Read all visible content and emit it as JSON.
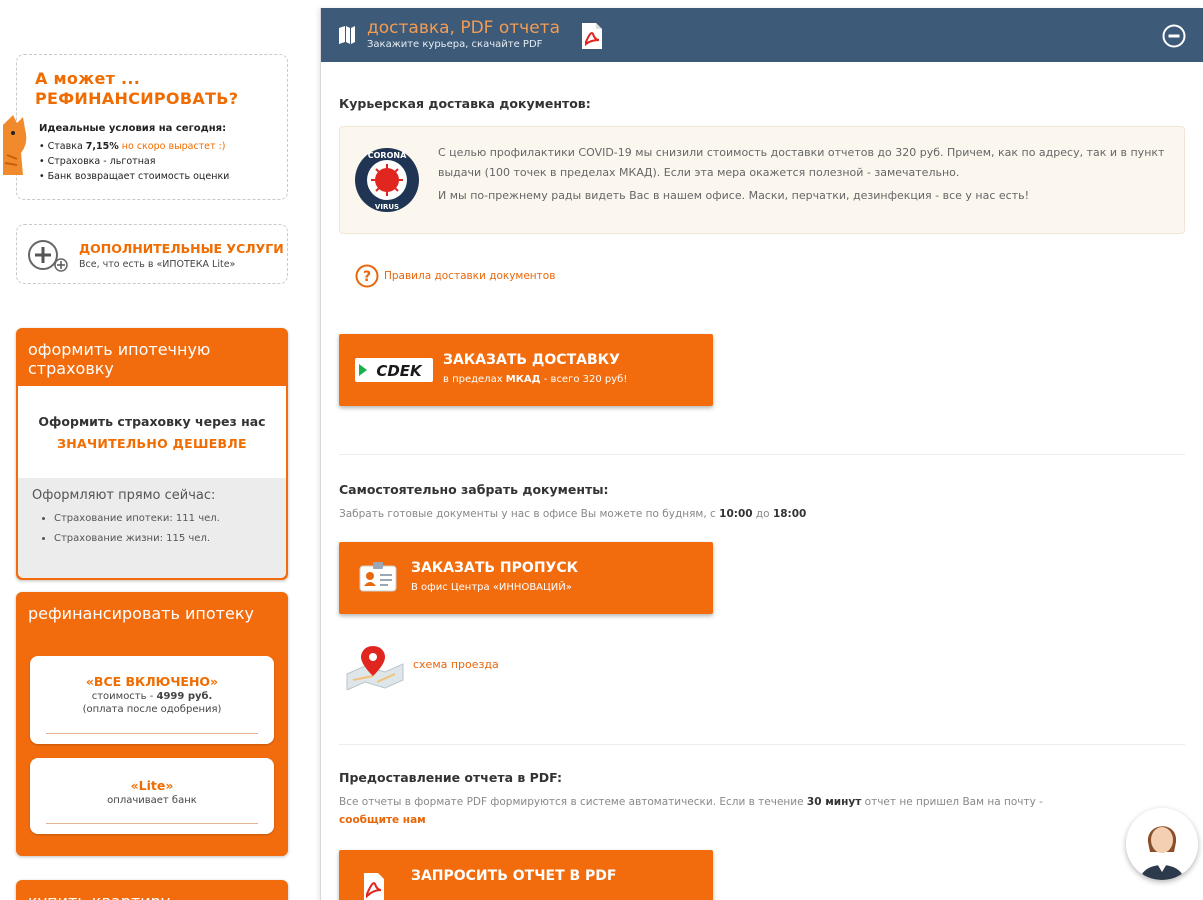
{
  "left": {
    "promo": {
      "title1": "А может ...",
      "title2": "РЕФИНАНСИРОВАТЬ?",
      "subtitle": "Идеальные условия на сегодня:",
      "bullet1_pre": "Ставка ",
      "bullet1_rate": "7,15%",
      "bullet1_note": " но скоро вырастет :)",
      "bullet2": "Страховка - льготная",
      "bullet3": "Банк возвращает стоимость оценки"
    },
    "additional": {
      "title": "ДОПОЛНИТЕЛЬНЫЕ УСЛУГИ",
      "subtitle": "Все, что есть в «ИПОТЕКА Lite»"
    },
    "insurance": {
      "heading": "оформить ипотечную страховку",
      "line1": "Оформить страховку через нас",
      "line2": "ЗНАЧИТЕЛЬНО ДЕШЕВЛЕ",
      "now_label": "Оформляют прямо сейчас:",
      "items": [
        "Страхование ипотеки: 111 чел.",
        "Страхование жизни: 115 чел."
      ]
    },
    "refinance": {
      "heading": "рефинансировать ипотеку",
      "card1_title": "«ВСЕ ВКЛЮЧЕНО»",
      "card1_price_label": "стоимость - ",
      "card1_price": "4999 руб.",
      "card1_note": "(оплата после одобрения)",
      "card2_title": "«Lite»",
      "card2_note": "оплачивает банк"
    },
    "next_heading": "купить квартиру"
  },
  "panel": {
    "title": "доставка, PDF отчета",
    "subtitle": "Закажите курьера, скачайте PDF",
    "courier_title": "Курьерская доставка документов:",
    "notice_p1": "С целью профилактики COVID-19 мы снизили стоимость доставки отчетов до 320 руб. Причем, как по адресу, так и в пункт выдачи (100 точек в пределах МКАД). Если эта мера окажется полезной - замечательно.",
    "notice_p2": "И мы по-прежнему рады видеть Вас в нашем офисе. Маски, перчатки, дезинфекция - все у нас есть!",
    "badge_top": "CORONA",
    "badge_bottom": "VIRUS",
    "rules_link": "Правила доставки документов",
    "cdek_logo": "CDEK",
    "delivery_button": "ЗАКАЗАТЬ ДОСТАВКУ",
    "delivery_sub_pre": "в пределах ",
    "delivery_sub_bold": "МКАД",
    "delivery_sub_post": " - всего 320 руб!",
    "pickup_title": "Самостоятельно забрать документы:",
    "pickup_desc_pre": "Забрать готовые документы у нас в офисе Вы можете по будням, с ",
    "pickup_from": "10:00",
    "pickup_mid": " до ",
    "pickup_to": "18:00",
    "pass_button": "ЗАКАЗАТЬ ПРОПУСК",
    "pass_sub": "В офис Центра «ИННОВАЦИЙ»",
    "route_link": "схема проезда",
    "pdf_title": "Предоставление отчета в PDF:",
    "pdf_desc_pre": "Все отчеты в формате PDF формируются в системе автоматически. Если в течение ",
    "pdf_desc_bold": "30 минут",
    "pdf_desc_post": " отчет не пришел Вам на почту -",
    "pdf_desc_link": "сообщите нам",
    "pdf_button": "ЗАПРОСИТЬ ОТЧЕТ В PDF"
  },
  "colors": {
    "accent": "#f26c0d",
    "header": "#3d5a78",
    "link": "#e8670b"
  }
}
